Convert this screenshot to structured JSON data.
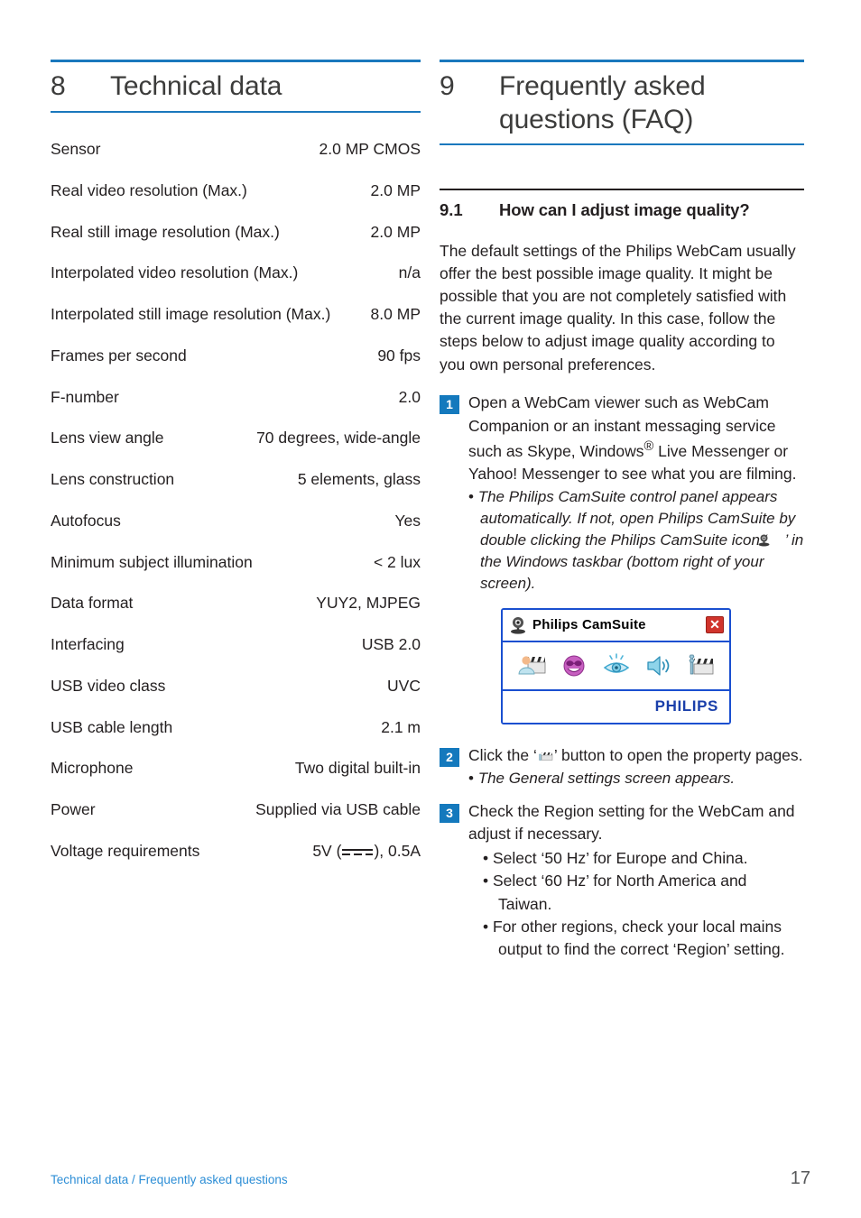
{
  "colors": {
    "accent_blue": "#1a78bd",
    "badge_blue": "#1479bd",
    "footer_link_blue": "#2d8ed6",
    "dialog_border_blue": "#1a4fd0",
    "philips_brand_blue": "#1a3faa",
    "close_button_red": "#d0342c",
    "body_text": "#231f20"
  },
  "left_column": {
    "chapter": {
      "number": "8",
      "title": "Technical data"
    },
    "spec_rows": [
      {
        "label": "Sensor",
        "value": "2.0 MP CMOS"
      },
      {
        "label": "Real video resolution (Max.)",
        "value": "2.0 MP"
      },
      {
        "label": "Real still image resolution (Max.)",
        "value": "2.0 MP"
      },
      {
        "label": "Interpolated video resolution (Max.)",
        "value": "n/a"
      },
      {
        "label": "Interpolated still image resolution (Max.)",
        "value": "8.0 MP"
      },
      {
        "label": "Frames per second",
        "value": "90 fps"
      },
      {
        "label": "F-number",
        "value": "2.0"
      },
      {
        "label": "Lens view angle",
        "value": "70 degrees, wide-angle"
      },
      {
        "label": "Lens construction",
        "value": "5 elements, glass"
      },
      {
        "label": "Autofocus",
        "value": "Yes"
      },
      {
        "label": "Minimum subject illumination",
        "value": "< 2 lux"
      },
      {
        "label": "Data format",
        "value": "YUY2, MJPEG"
      },
      {
        "label": "Interfacing",
        "value": "USB 2.0"
      },
      {
        "label": "USB video class",
        "value": "UVC"
      },
      {
        "label": "USB cable length",
        "value": "2.1 m"
      },
      {
        "label": "Microphone",
        "value": "Two digital built-in"
      },
      {
        "label": "Power",
        "value": "Supplied via USB cable"
      }
    ],
    "voltage_row": {
      "label": "Voltage requirements",
      "value_prefix": "5V (",
      "value_suffix": "), 0.5A",
      "symbol_name": "dc-power-symbol"
    }
  },
  "right_column": {
    "chapter": {
      "number": "9",
      "title": "Frequently asked questions (FAQ)"
    },
    "section": {
      "number": "9.1",
      "title": "How can I adjust image quality?"
    },
    "intro_paragraph": "The default settings of the Philips WebCam usually offer the best possible image quality. It might be possible that you are not completely satisfied with the current image quality. In this case, follow the steps below to adjust image quality according to you own personal preferences.",
    "steps": [
      {
        "number": "1",
        "text_before": "Open a WebCam viewer such as WebCam Companion or an instant messaging service such as Skype, Windows",
        "superscript": "®",
        "text_after": " Live Messenger or Yahoo! Messenger to see what you are filming.",
        "notes_before_icon": "The Philips CamSuite control panel appears automatically. If not, open Philips CamSuite by double clicking the Philips CamSuite icon ‘",
        "notes_after_icon": "’ in the Windows taskbar (bottom right of your screen)."
      },
      {
        "number": "2",
        "text_before": "Click the ‘",
        "text_after": "’ button to open the property pages.",
        "note": "The General settings screen appears."
      },
      {
        "number": "3",
        "text": "Check the Region setting for the WebCam and adjust if necessary.",
        "bullets": [
          "Select ‘50 Hz’ for Europe and China.",
          "Select ‘60 Hz’ for North America and Taiwan.",
          "For other regions, check your local mains output to find the correct ‘Region’ setting."
        ]
      }
    ],
    "camsuite_dialog": {
      "title": "Philips CamSuite",
      "close_label": "✕",
      "brand": "PHILIPS",
      "icons": [
        "webcam-companion-icon",
        "fun-effects-icon",
        "image-settings-icon",
        "audio-settings-icon",
        "properties-settings-icon"
      ]
    }
  },
  "footer": {
    "breadcrumb": "Technical data / Frequently asked questions",
    "page_number": "17"
  }
}
